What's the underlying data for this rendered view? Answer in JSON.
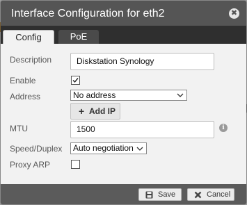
{
  "dialog": {
    "title": "Interface Configuration for eth2",
    "close_glyph": "✖"
  },
  "tabs": [
    {
      "label": "Config",
      "active": true
    },
    {
      "label": "PoE",
      "active": false
    }
  ],
  "form": {
    "description": {
      "label": "Description",
      "value": "Diskstation Synology"
    },
    "enable": {
      "label": "Enable",
      "checked": true
    },
    "address": {
      "label": "Address",
      "value": "No address",
      "add_button": "Add IP"
    },
    "mtu": {
      "label": "MTU",
      "value": "1500"
    },
    "speed_duplex": {
      "label": "Speed/Duplex",
      "value": "Auto negotiation"
    },
    "proxy_arp": {
      "label": "Proxy ARP",
      "checked": false
    }
  },
  "footer": {
    "save_label": "Save",
    "cancel_label": "Cancel"
  },
  "colors": {
    "titlebar": "#555555",
    "tabbar": "#2f2f2f",
    "content": "#f2f2f2",
    "backdrop": "#a3a3a3"
  },
  "icons": {
    "close": "close-icon",
    "check": "checkmark-icon",
    "dropdown": "chevron-down-icon",
    "add": "plus-icon",
    "info": "info-icon",
    "save": "floppy-disk-icon",
    "cancel": "x-icon"
  }
}
